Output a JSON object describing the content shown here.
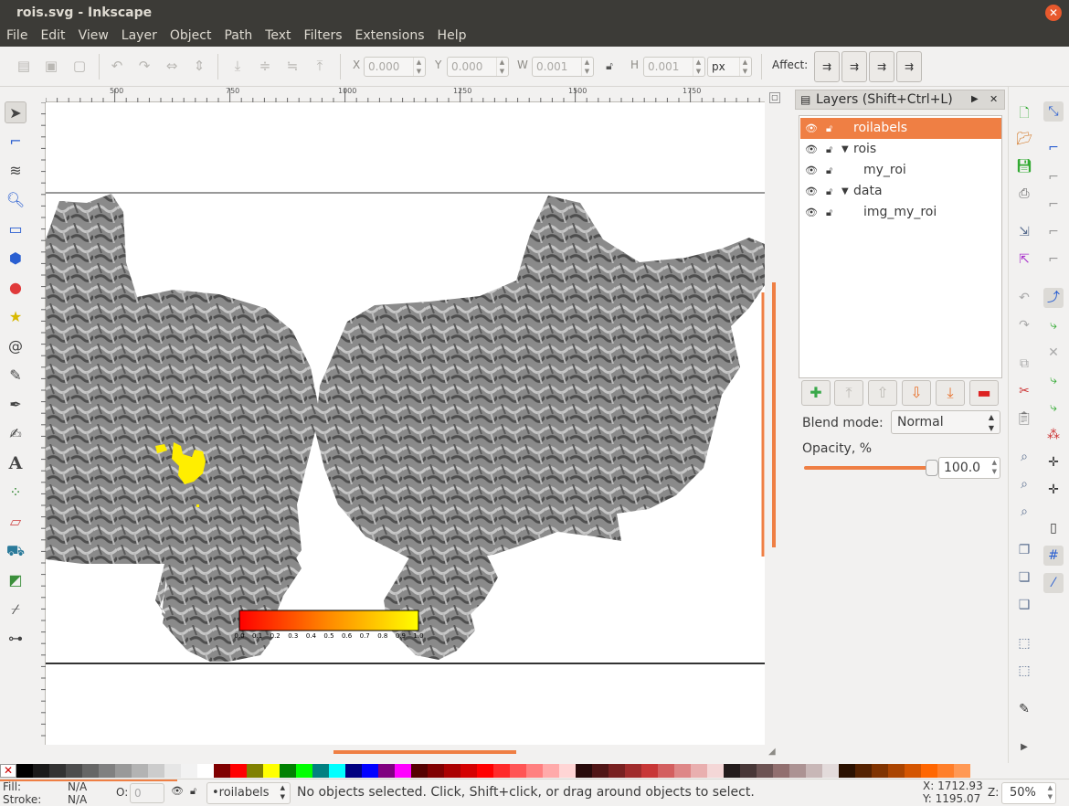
{
  "window": {
    "title": "rois.svg - Inkscape"
  },
  "menu": [
    "File",
    "Edit",
    "View",
    "Layer",
    "Object",
    "Path",
    "Text",
    "Filters",
    "Extensions",
    "Help"
  ],
  "toolbar": {
    "x_label": "X",
    "x_value": "0.000",
    "y_label": "Y",
    "y_value": "0.000",
    "w_label": "W",
    "w_value": "0.001",
    "h_label": "H",
    "h_value": "0.001",
    "unit": "px",
    "affect_label": "Affect:"
  },
  "rulers": {
    "h_ticks": [
      "500",
      "750",
      "1000",
      "1250",
      "1500",
      "1750"
    ]
  },
  "layers_panel": {
    "title": "Layers (Shift+Ctrl+L)",
    "layers": [
      {
        "name": "roilabels",
        "selected": true,
        "expander": ""
      },
      {
        "name": "rois",
        "selected": false,
        "expander": "▼"
      },
      {
        "name": "my_roi",
        "selected": false,
        "expander": ""
      },
      {
        "name": "data",
        "selected": false,
        "expander": "▼"
      },
      {
        "name": "img_my_roi",
        "selected": false,
        "expander": ""
      }
    ],
    "blend_label": "Blend mode:",
    "blend_value": "Normal",
    "opacity_label": "Opacity, %",
    "opacity_value": "100.0",
    "opacity_fraction": 1.0
  },
  "colorbar": {
    "ticks": [
      "0.0",
      "0.1",
      "0.2",
      "0.3",
      "0.4",
      "0.5",
      "0.6",
      "0.7",
      "0.8",
      "0.9",
      "1.0"
    ]
  },
  "status": {
    "fill_label": "Fill:",
    "fill_value": "N/A",
    "stroke_label": "Stroke:",
    "stroke_value": "N/A",
    "opacity_label": "O:",
    "opacity_value": "0",
    "layer_select": "•roilabels",
    "message": "No objects selected. Click, Shift+click, or drag around objects to select.",
    "x_readout": "X: 1712.93",
    "y_readout": "Y: 1195.07",
    "zoom_label": "Z:",
    "zoom_value": "50%"
  },
  "colors": {
    "accent": "#ef7f44",
    "titlebar": "#3c3b37",
    "roi": "#ffee00"
  },
  "palette": [
    "#000000",
    "#1a1a1a",
    "#333333",
    "#4d4d4d",
    "#666666",
    "#808080",
    "#999999",
    "#b3b3b3",
    "#cccccc",
    "#e6e6e6",
    "#f2f2f2",
    "#ffffff",
    "#800000",
    "#ff0000",
    "#808000",
    "#ffff00",
    "#008000",
    "#00ff00",
    "#008080",
    "#00ffff",
    "#000080",
    "#0000ff",
    "#800080",
    "#ff00ff",
    "#550000",
    "#800000",
    "#aa0000",
    "#d40000",
    "#ff0000",
    "#ff2a2a",
    "#ff5555",
    "#ff8080",
    "#ffaaaa",
    "#ffd5d5",
    "#280b0b",
    "#501616",
    "#782121",
    "#a02c2c",
    "#c83737",
    "#d35f5f",
    "#de8787",
    "#e9afaf",
    "#f4d7d7",
    "#241c1c",
    "#483737",
    "#6c5353",
    "#916f6f",
    "#ac9393",
    "#c8b7b7",
    "#e3dbdb",
    "#2b1100",
    "#552200",
    "#803300",
    "#aa4400",
    "#d45500",
    "#ff6600",
    "#ff7f2a",
    "#ff9955"
  ]
}
